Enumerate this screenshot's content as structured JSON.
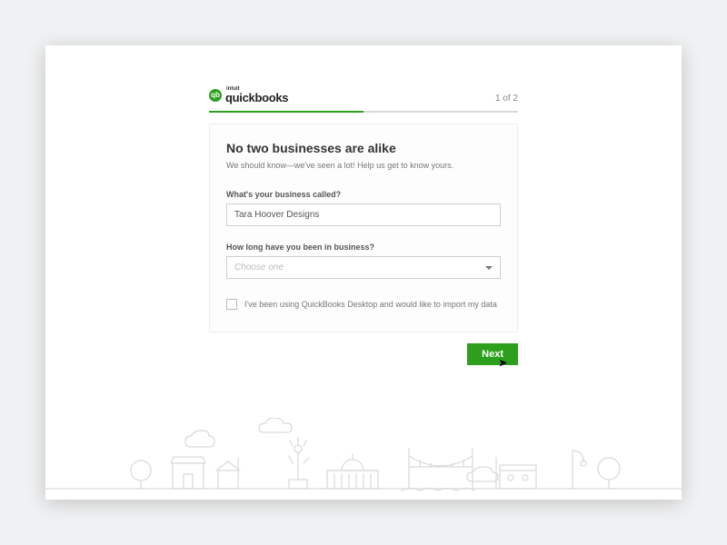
{
  "brand": {
    "intuit": "intuit",
    "product": "quickbooks",
    "badge": "qb"
  },
  "progress": {
    "step_text": "1 of 2",
    "percent": 50
  },
  "form": {
    "heading": "No two businesses are alike",
    "subheading": "We should know—we've seen a lot! Help us get to know yours.",
    "business_name_label": "What's your business called?",
    "business_name_value": "Tara Hoover Designs",
    "duration_label": "How long have you been in business?",
    "duration_placeholder": "Choose one",
    "import_checkbox_label": "I've been using QuickBooks Desktop and would like to import my data",
    "import_checked": false
  },
  "actions": {
    "next_label": "Next"
  },
  "colors": {
    "brand_green": "#2ca01c"
  }
}
